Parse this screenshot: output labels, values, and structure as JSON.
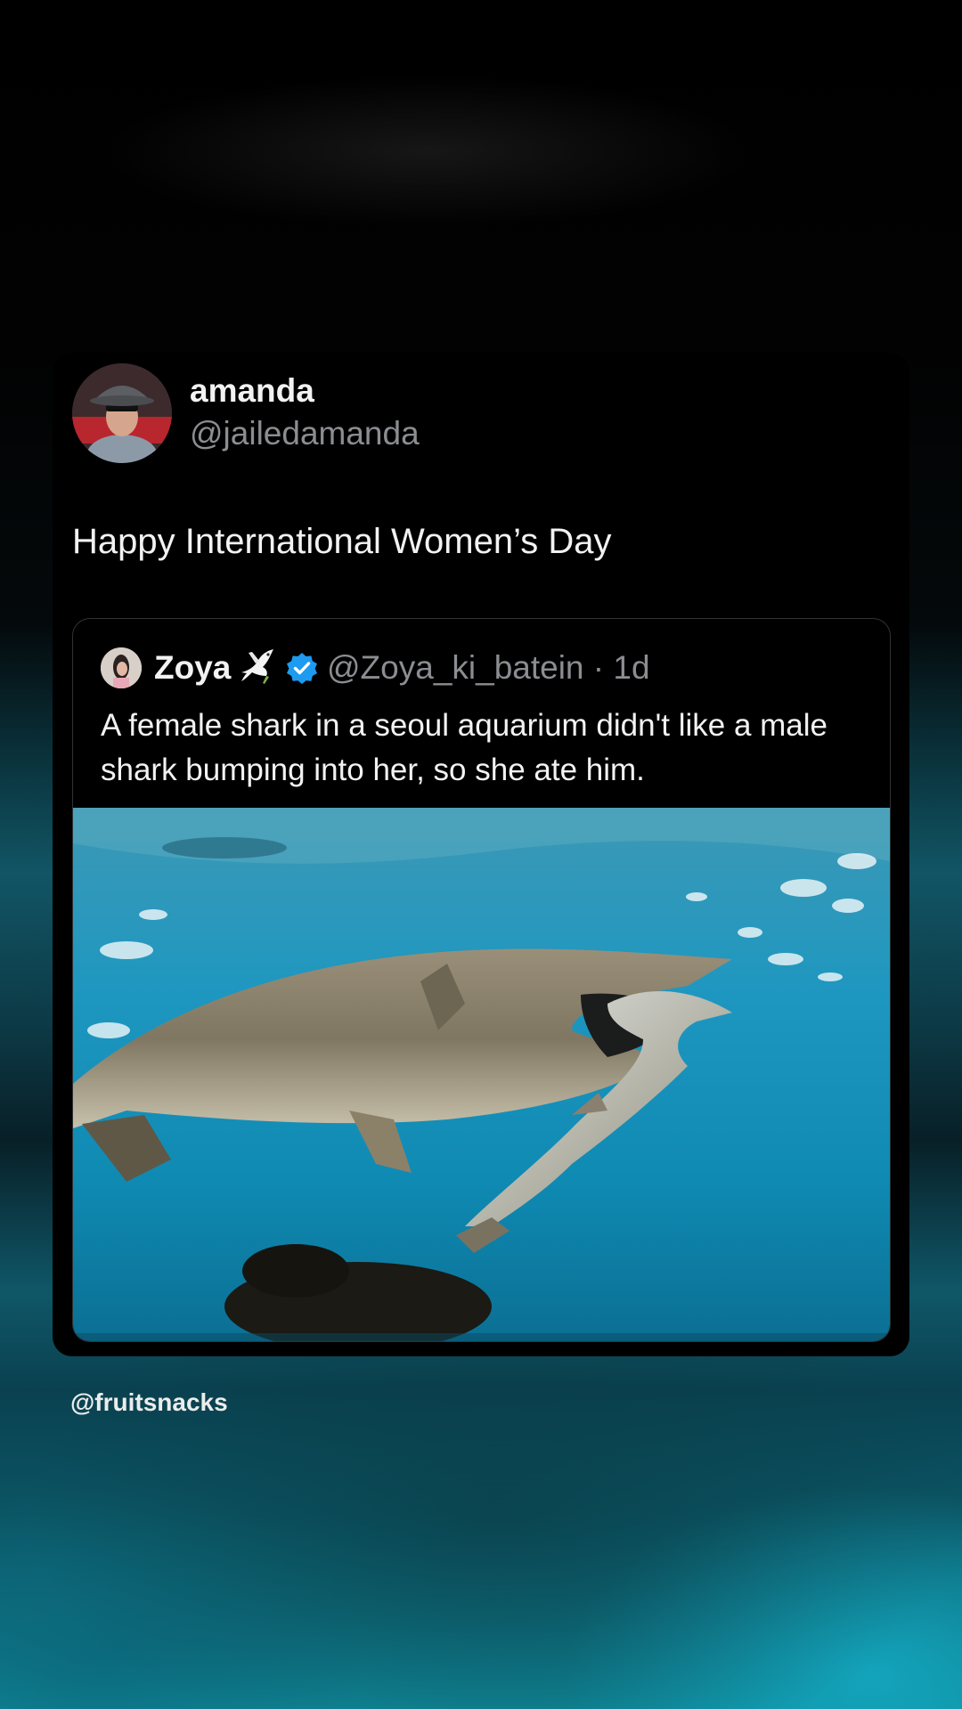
{
  "post": {
    "author": {
      "display_name": "amanda",
      "handle": "@jailedamanda",
      "avatar_icon": "profile-photo"
    },
    "text": "Happy International Women’s Day",
    "quoted": {
      "author": {
        "display_name": "Zoya",
        "emoji_icon": "dove-icon",
        "verified_icon": "verified-badge-icon",
        "handle": "@Zoya_ki_batein",
        "age": "1d"
      },
      "text": "A female shark in a seoul aquarium didn't like a male shark bumping into her, so she ate him.",
      "media": {
        "kind": "photo",
        "subject": "shark-eating-shark-photo"
      }
    }
  },
  "watermark": "@fruitsnacks",
  "colors": {
    "verified_blue": "#1d9bf0",
    "secondary_text": "#8b8d91",
    "water_teal": "#1aa3c6"
  }
}
